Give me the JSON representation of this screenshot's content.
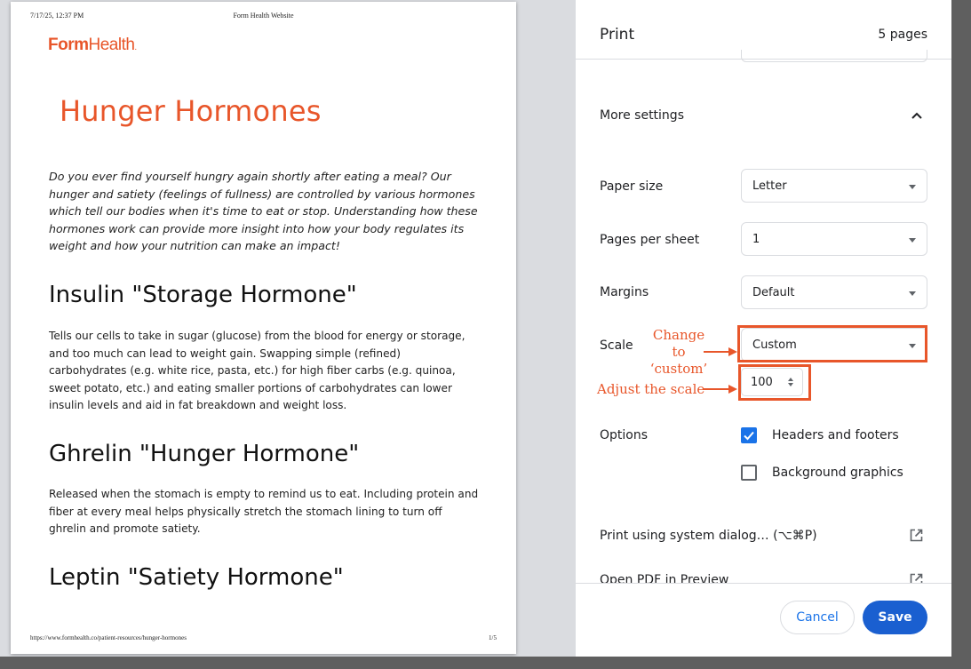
{
  "preview": {
    "header_date": "7/17/25, 12:37 PM",
    "header_site": "Form Health Website",
    "logo_bold": "Form",
    "logo_regular": "Health",
    "logo_dot": ".",
    "title": "Hunger Hormones",
    "intro": "Do you ever find yourself hungry again shortly after eating a meal? Our hunger and satiety (feelings of fullness) are controlled by various hormones which tell our bodies when it's time to eat or stop. Understanding how these hormones work can provide more insight into how your body regulates its weight and how your nutrition can make an impact!",
    "sections": [
      {
        "heading": "Insulin \"Storage Hormone\"",
        "body": "Tells our cells to take in sugar (glucose) from the blood for energy or storage, and too much can lead to weight gain. Swapping simple (refined) carbohydrates (e.g. white rice, pasta, etc.) for high fiber carbs (e.g. quinoa, sweet potato, etc.) and eating smaller portions of carbohydrates can lower insulin levels and aid in fat breakdown and weight loss."
      },
      {
        "heading": "Ghrelin \"Hunger Hormone\"",
        "body": "Released when the stomach is empty to remind us to eat. Including protein and fiber at every meal helps physically stretch the stomach lining to turn off ghrelin and promote satiety."
      },
      {
        "heading": "Leptin \"Satiety Hormone\"",
        "body": ""
      }
    ],
    "footer_url": "https://www.formhealth.co/patient-resources/hunger-hormones",
    "footer_page": "1/5"
  },
  "panel": {
    "title": "Print",
    "pages": "5 pages",
    "more_settings": "More settings",
    "paper_size": {
      "label": "Paper size",
      "value": "Letter"
    },
    "pages_per_sheet": {
      "label": "Pages per sheet",
      "value": "1"
    },
    "margins": {
      "label": "Margins",
      "value": "Default"
    },
    "scale": {
      "label": "Scale",
      "value": "Custom",
      "custom_value": "100"
    },
    "options": {
      "label": "Options",
      "headers_footers": {
        "label": "Headers and footers",
        "checked": true
      },
      "background_graphics": {
        "label": "Background graphics",
        "checked": false
      }
    },
    "system_dialog": "Print using system dialog… (⌥⌘P)",
    "open_pdf": "Open PDF in Preview",
    "cancel": "Cancel",
    "save": "Save"
  },
  "annotations": {
    "change_line1": "Change to",
    "change_line2": "‘custom’",
    "adjust": "Adjust the scale",
    "color": "#e8562a"
  },
  "colors": {
    "brand": "#e8562a",
    "accent_blue": "#1a73e8",
    "save_blue": "#1a5fd0"
  }
}
